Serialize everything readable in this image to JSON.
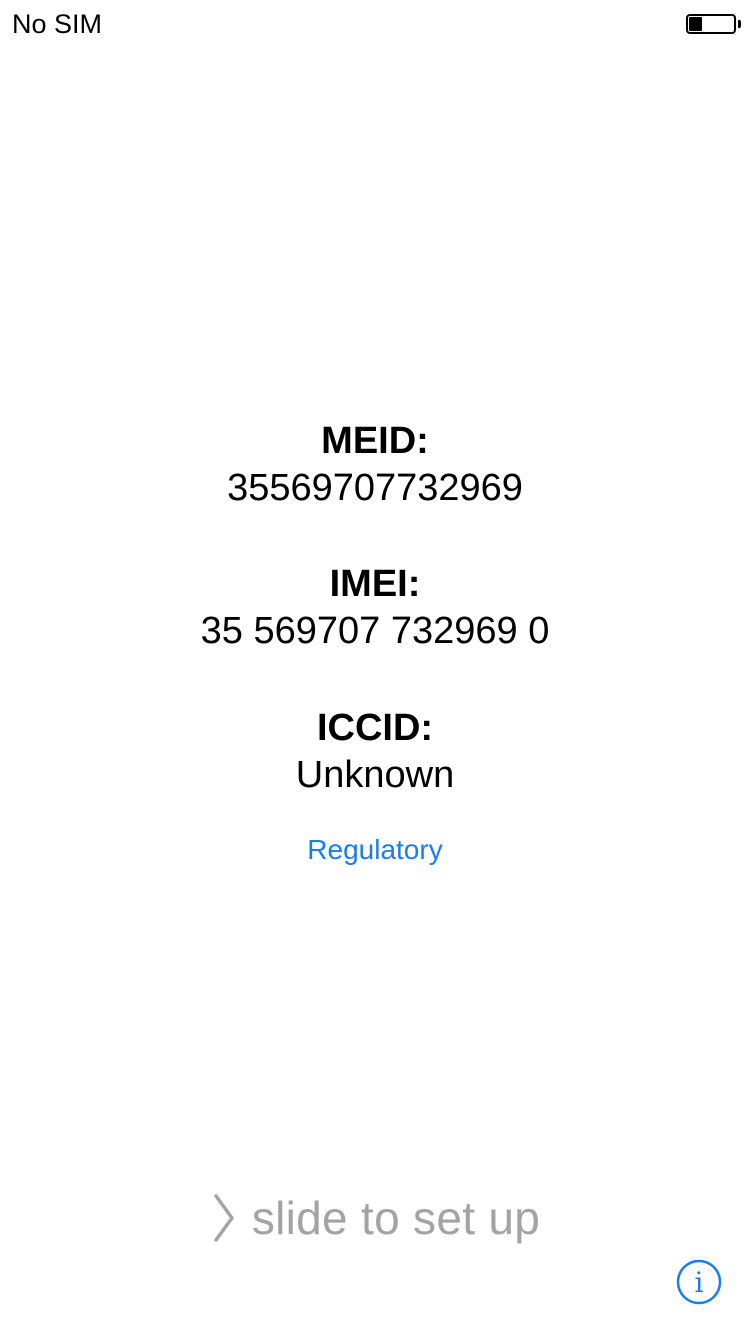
{
  "status_bar": {
    "carrier": "No SIM",
    "battery_level": 0.3
  },
  "device_info": {
    "meid_label": "MEID:",
    "meid_value": "35569707732969",
    "imei_label": "IMEI:",
    "imei_value": "35 569707 732969 0",
    "iccid_label": "ICCID:",
    "iccid_value": "Unknown"
  },
  "regulatory_link": "Regulatory",
  "slide_to_unlock": {
    "text": "slide to set up"
  },
  "colors": {
    "accent": "#1a7ee8",
    "slide_text": "#a3a3a3"
  },
  "icons": {
    "battery": "battery-icon",
    "chevron": "chevron-right-icon",
    "info": "info-icon"
  }
}
